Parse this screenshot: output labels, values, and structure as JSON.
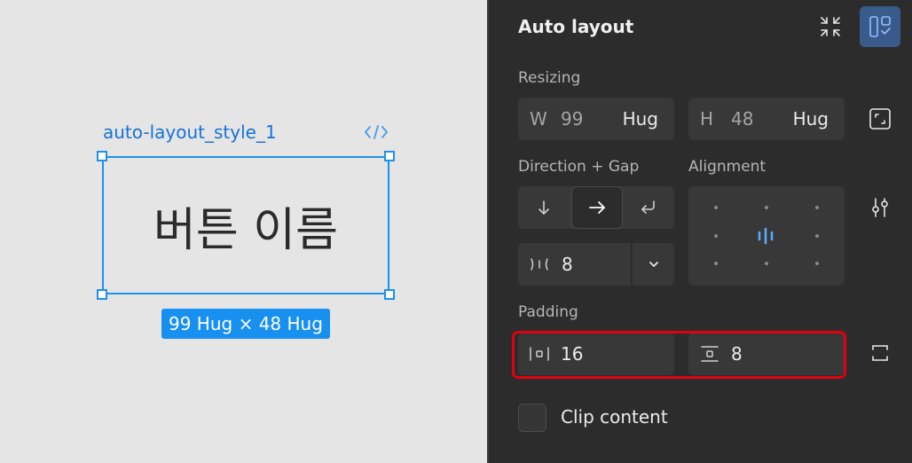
{
  "canvas": {
    "frame_name": "auto-layout_style_1",
    "layer_text": "버튼 이름",
    "size_badge": "99 Hug × 48 Hug"
  },
  "panel": {
    "title": "Auto layout",
    "resizing": {
      "label": "Resizing",
      "width": {
        "prefix": "W",
        "value": "99",
        "mode": "Hug"
      },
      "height": {
        "prefix": "H",
        "value": "48",
        "mode": "Hug"
      }
    },
    "direction_gap": {
      "label": "Direction + Gap",
      "options": [
        "vertical",
        "horizontal",
        "wrap"
      ],
      "selected": "horizontal",
      "gap_value": "8"
    },
    "alignment": {
      "label": "Alignment",
      "selected": "center"
    },
    "padding": {
      "label": "Padding",
      "horizontal": "16",
      "vertical": "8"
    },
    "clip_content": {
      "label": "Clip content",
      "checked": false
    }
  },
  "colors": {
    "accent": "#1e90ef",
    "highlight": "#e0000f",
    "active_button": "#3a5a8c"
  }
}
